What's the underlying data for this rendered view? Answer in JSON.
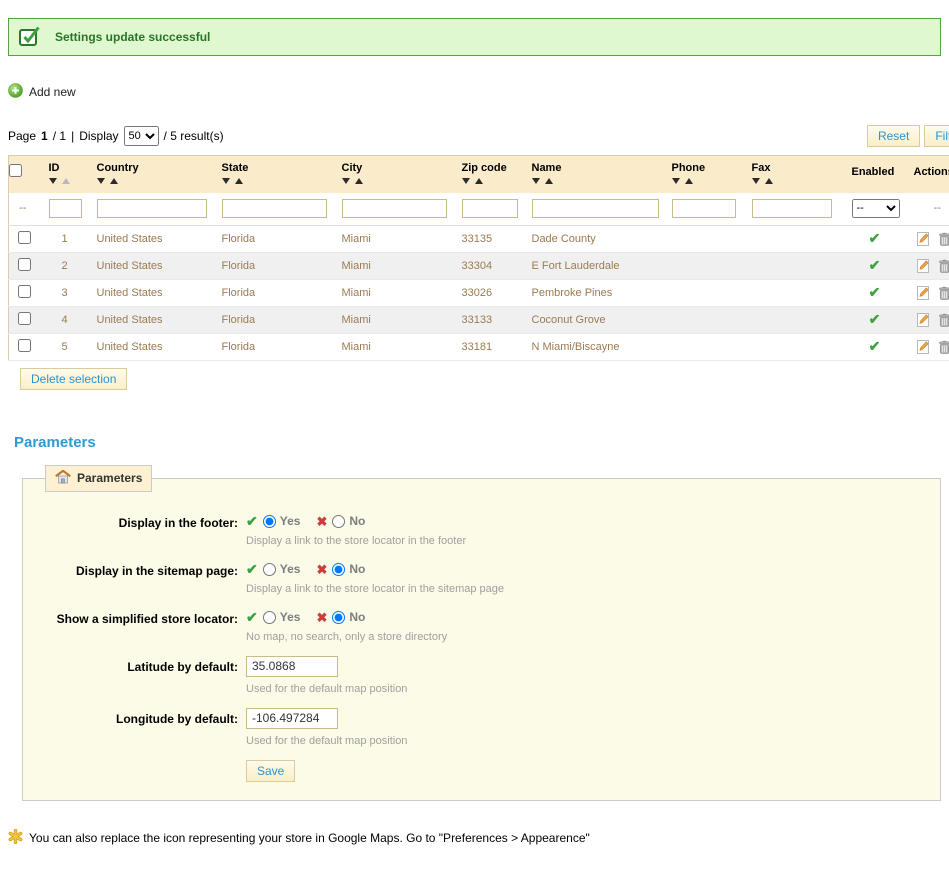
{
  "banner": {
    "text": "Settings update successful"
  },
  "toolbar": {
    "add_new": "Add new"
  },
  "pagination": {
    "page_word": "Page",
    "page_current": "1",
    "page_total": "/ 1",
    "divider": "|",
    "display_word": "Display",
    "per_page": "50",
    "results_suffix": "/ 5 result(s)"
  },
  "buttons": {
    "reset": "Reset",
    "filter": "Filter",
    "delete_selection": "Delete selection",
    "save": "Save"
  },
  "table": {
    "columns": [
      {
        "label": "ID"
      },
      {
        "label": "Country"
      },
      {
        "label": "State"
      },
      {
        "label": "City"
      },
      {
        "label": "Zip code"
      },
      {
        "label": "Name"
      },
      {
        "label": "Phone"
      },
      {
        "label": "Fax"
      },
      {
        "label": "Enabled"
      },
      {
        "label": "Actions"
      }
    ],
    "check_all_filter": "--",
    "enabled_filter": "--",
    "actions_filter": "--",
    "filters": {
      "id": "",
      "country": "",
      "state": "",
      "city": "",
      "zip": "",
      "name": "",
      "phone": "",
      "fax": ""
    },
    "rows": [
      {
        "id": "1",
        "country": "United States",
        "state": "Florida",
        "city": "Miami",
        "zip": "33135",
        "name": "Dade County",
        "phone": "",
        "fax": "",
        "enabled": true
      },
      {
        "id": "2",
        "country": "United States",
        "state": "Florida",
        "city": "Miami",
        "zip": "33304",
        "name": "E Fort Lauderdale",
        "phone": "",
        "fax": "",
        "enabled": true
      },
      {
        "id": "3",
        "country": "United States",
        "state": "Florida",
        "city": "Miami",
        "zip": "33026",
        "name": "Pembroke Pines",
        "phone": "",
        "fax": "",
        "enabled": true
      },
      {
        "id": "4",
        "country": "United States",
        "state": "Florida",
        "city": "Miami",
        "zip": "33133",
        "name": "Coconut Grove",
        "phone": "",
        "fax": "",
        "enabled": true
      },
      {
        "id": "5",
        "country": "United States",
        "state": "Florida",
        "city": "Miami",
        "zip": "33181",
        "name": "N Miami/Biscayne",
        "phone": "",
        "fax": "",
        "enabled": true
      }
    ]
  },
  "parameters": {
    "heading": "Parameters",
    "legend": "Parameters",
    "fields": [
      {
        "label": "Display in the footer:",
        "yes_label": "Yes",
        "no_label": "No",
        "selected": "yes",
        "hint": "Display a link to the store locator in the footer"
      },
      {
        "label": "Display in the sitemap page:",
        "yes_label": "Yes",
        "no_label": "No",
        "selected": "no",
        "hint": "Display a link to the store locator in the sitemap page"
      },
      {
        "label": "Show a simplified store locator:",
        "yes_label": "Yes",
        "no_label": "No",
        "selected": "no",
        "hint": "No map, no search, only a store directory"
      },
      {
        "label": "Latitude by default:",
        "value": "35.0868",
        "hint": "Used for the default map position"
      },
      {
        "label": "Longitude by default:",
        "value": "-106.497284",
        "hint": "Used for the default map position"
      }
    ]
  },
  "footnote": {
    "text": "You can also replace the icon representing your store in Google Maps. Go to \"Preferences > Appearence\""
  },
  "colors": {
    "accent_blue": "#2B93D1",
    "success_green": "#3FA33F",
    "error_red": "#D03C3C",
    "header_beige": "#FAECCB"
  }
}
